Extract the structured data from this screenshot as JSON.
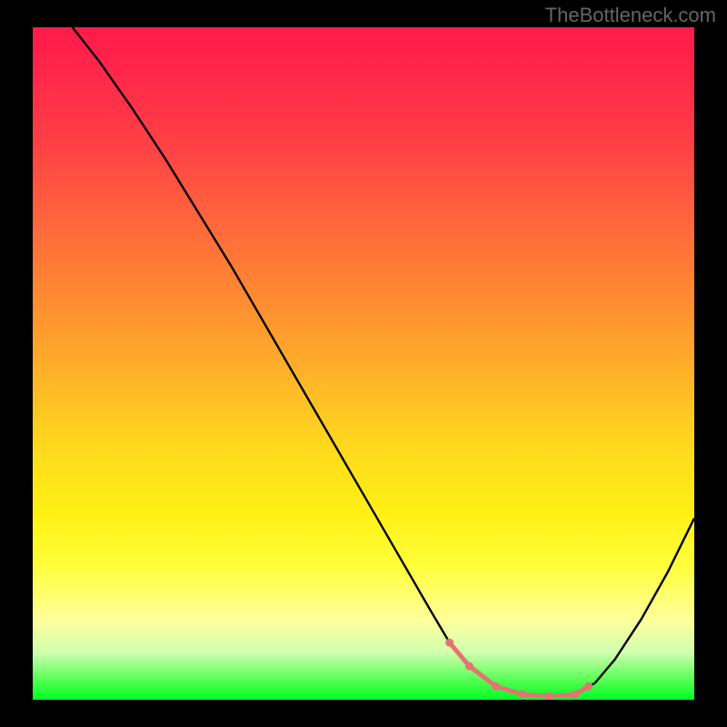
{
  "watermark": "TheBottleneck.com",
  "chart_data": {
    "type": "line",
    "title": "",
    "xlabel": "",
    "ylabel": "",
    "xlim": [
      0,
      100
    ],
    "ylim": [
      0,
      100
    ],
    "series": [
      {
        "name": "curve",
        "color": "#000000",
        "x": [
          6,
          10,
          15,
          20,
          25,
          30,
          35,
          40,
          45,
          50,
          55,
          60,
          63,
          66,
          70,
          74,
          78,
          82,
          85,
          88,
          92,
          96,
          100
        ],
        "y": [
          100,
          95,
          88,
          80.5,
          72.5,
          64.5,
          56,
          47.5,
          39,
          30.5,
          22,
          13.5,
          8.5,
          5,
          2,
          0.8,
          0.5,
          0.8,
          2.5,
          6,
          12,
          19,
          27
        ]
      },
      {
        "name": "highlight-band",
        "color": "#e57373",
        "x": [
          63,
          66,
          70,
          74,
          78,
          82,
          84
        ],
        "y": [
          8.5,
          5,
          2,
          0.8,
          0.5,
          0.8,
          2.0
        ]
      }
    ],
    "gradient_stops": [
      {
        "pct": 0,
        "color": "#ff1a4a"
      },
      {
        "pct": 18,
        "color": "#ff4244"
      },
      {
        "pct": 40,
        "color": "#ff8a32"
      },
      {
        "pct": 62,
        "color": "#ffd81e"
      },
      {
        "pct": 80,
        "color": "#ffff3a"
      },
      {
        "pct": 93,
        "color": "#d0ffb0"
      },
      {
        "pct": 100,
        "color": "#00ff2a"
      }
    ]
  }
}
